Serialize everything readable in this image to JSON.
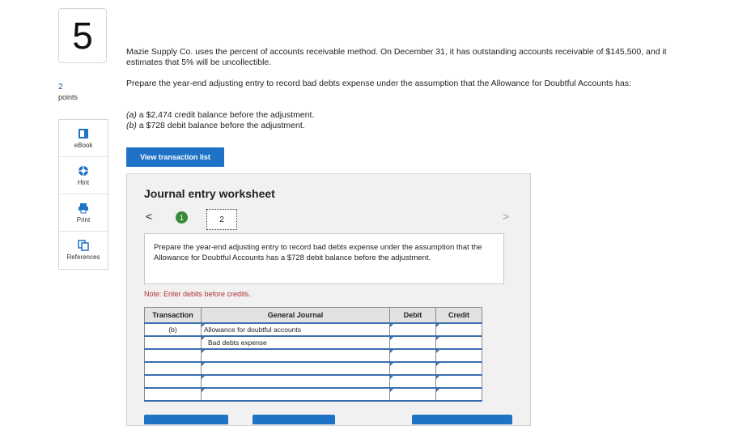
{
  "question": {
    "number": "5",
    "points_value": "2",
    "points_label": "points"
  },
  "side_tools": [
    {
      "label": "eBook",
      "icon": "book-icon"
    },
    {
      "label": "Hint",
      "icon": "lifebuoy-icon"
    },
    {
      "label": "Print",
      "icon": "printer-icon"
    },
    {
      "label": "References",
      "icon": "copy-icon"
    }
  ],
  "prompt": {
    "p1": "Mazie Supply Co. uses the percent of accounts receivable method. On December 31, it has outstanding accounts receivable of $145,500, and it estimates that 5% will be uncollectible.",
    "p2": "Prepare the year-end adjusting entry to record bad debts expense under the assumption that the Allowance for Doubtful Accounts has:",
    "a_label": "(a)",
    "a_text": " a $2,474 credit balance before the adjustment.",
    "b_label": "(b)",
    "b_text": " a $728 debit balance before the adjustment."
  },
  "view_transaction_button": "View transaction list",
  "worksheet": {
    "title": "Journal entry worksheet",
    "prev": "<",
    "next": ">",
    "steps": [
      "1",
      "2"
    ],
    "instruction": "Prepare the year-end adjusting entry to record bad debts expense under the assumption that the Allowance for Doubtful Accounts has a $728 debit balance before the adjustment.",
    "note": "Note: Enter debits before credits.",
    "columns": [
      "Transaction",
      "General Journal",
      "Debit",
      "Credit"
    ],
    "rows": [
      {
        "transaction": "(b)",
        "account": "Allowance for doubtful accounts",
        "debit": "",
        "credit": ""
      },
      {
        "transaction": "",
        "account": "Bad debts expense",
        "debit": "",
        "credit": ""
      },
      {
        "transaction": "",
        "account": "",
        "debit": "",
        "credit": ""
      },
      {
        "transaction": "",
        "account": "",
        "debit": "",
        "credit": ""
      },
      {
        "transaction": "",
        "account": "",
        "debit": "",
        "credit": ""
      },
      {
        "transaction": "",
        "account": "",
        "debit": "",
        "credit": ""
      }
    ]
  }
}
